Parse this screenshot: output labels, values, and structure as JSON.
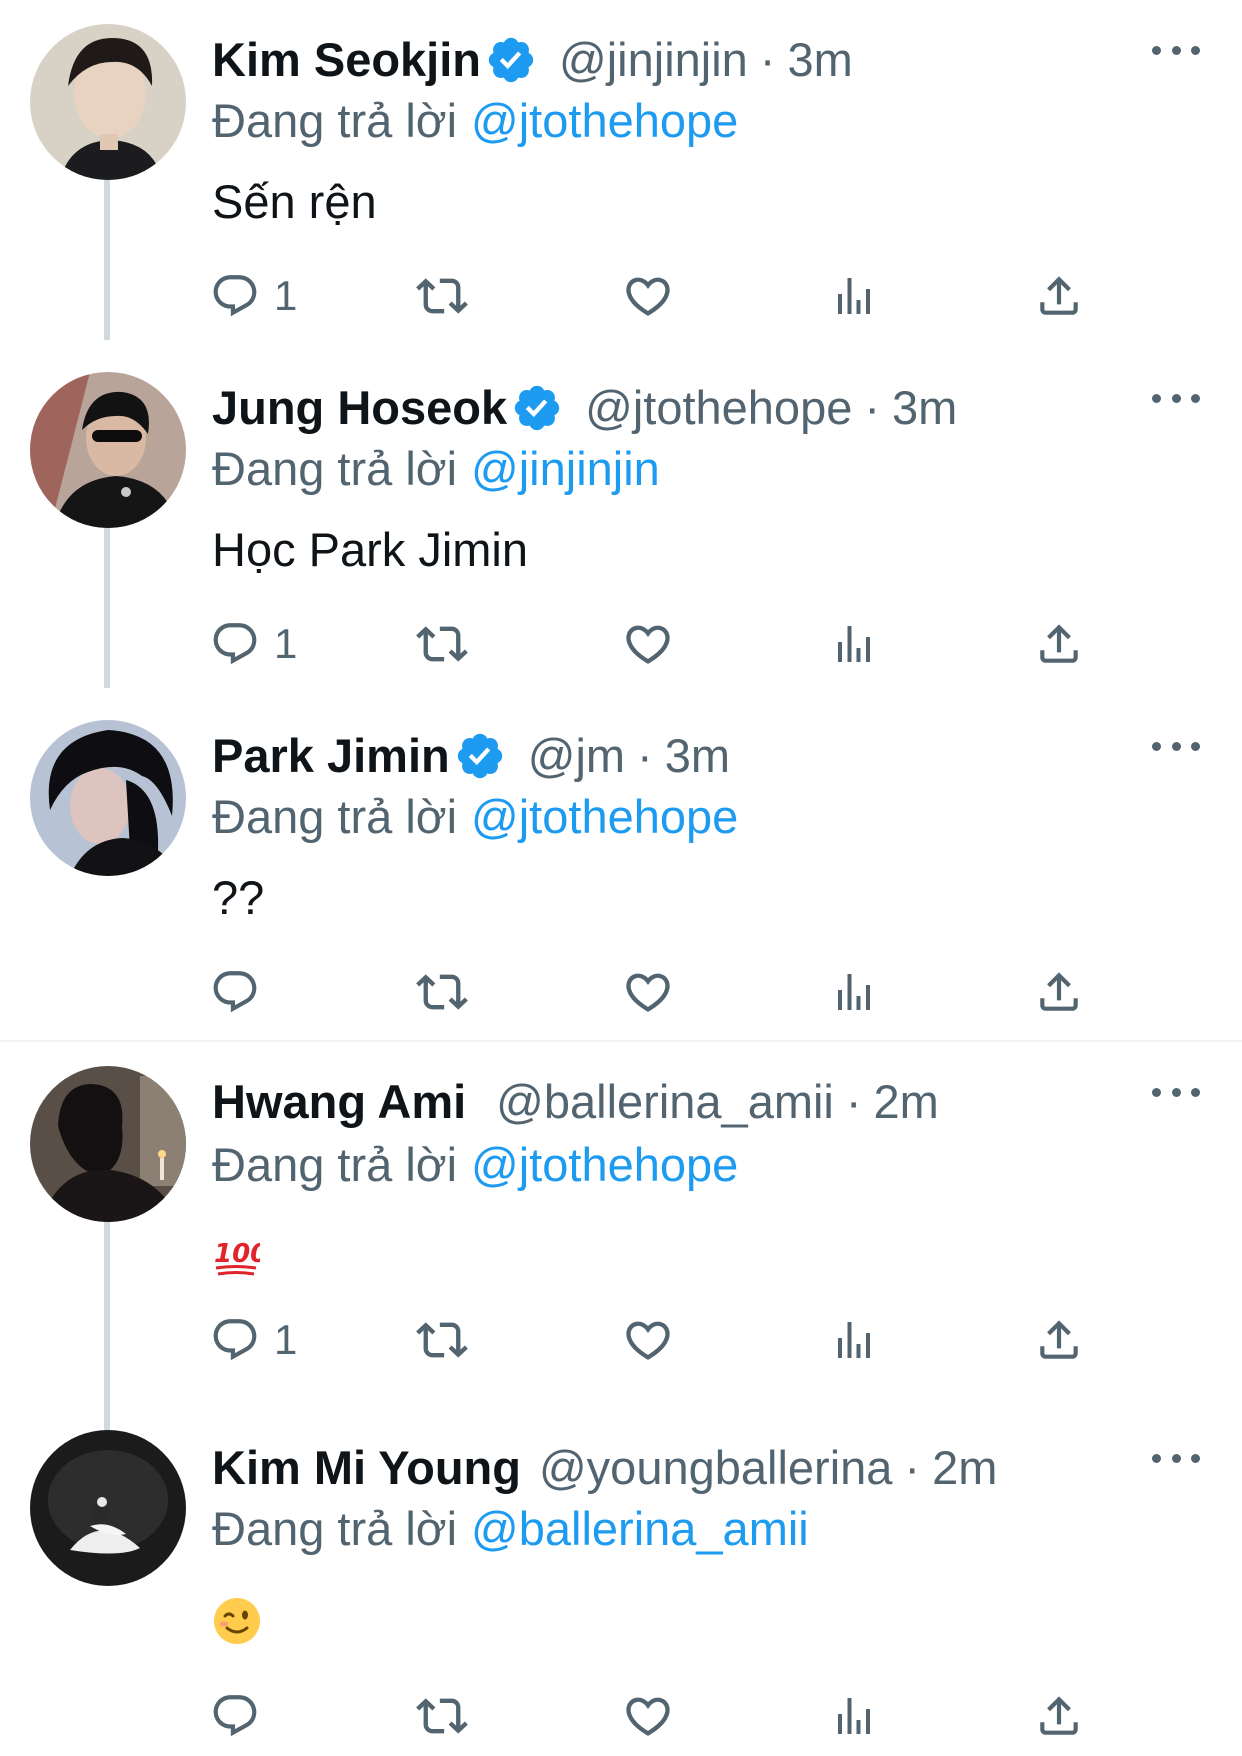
{
  "accent_color": "#1d9bf0",
  "replying_prefix": "Đang trả lời",
  "tweets": [
    {
      "name": "Kim Seokjin",
      "verified": true,
      "handle": "@jinjinjin",
      "separator": "·",
      "time": "3m",
      "replying_to": "@jtothehope",
      "text": "Sến rện",
      "reply_count": "1",
      "avatar": "avatar-kim-seokjin"
    },
    {
      "name": "Jung Hoseok",
      "verified": true,
      "handle": "@jtothehope",
      "separator": "·",
      "time": "3m",
      "replying_to": "@jinjinjin",
      "text": "Học Park Jimin",
      "reply_count": "1",
      "avatar": "avatar-jung-hoseok"
    },
    {
      "name": "Park Jimin",
      "verified": true,
      "handle": "@jm",
      "separator": "·",
      "time": "3m",
      "replying_to": "@jtothehope",
      "text": "??",
      "reply_count": "",
      "avatar": "avatar-park-jimin"
    },
    {
      "name": "Hwang Ami",
      "verified": false,
      "handle": "@ballerina_amii",
      "separator": "·",
      "time": "2m",
      "replying_to": "@jtothehope",
      "text_emoji": "hundred-points-emoji",
      "reply_count": "1",
      "avatar": "avatar-hwang-ami"
    },
    {
      "name": "Kim Mi Young",
      "verified": false,
      "handle": "@youngballerina",
      "separator": "·",
      "time": "2m",
      "replying_to": "@ballerina_amii",
      "text_emoji": "winking-face-emoji",
      "reply_count": "",
      "avatar": "avatar-kim-mi-young"
    }
  ],
  "action_icons": [
    "reply-icon",
    "retweet-icon",
    "like-icon",
    "views-icon",
    "share-icon"
  ]
}
